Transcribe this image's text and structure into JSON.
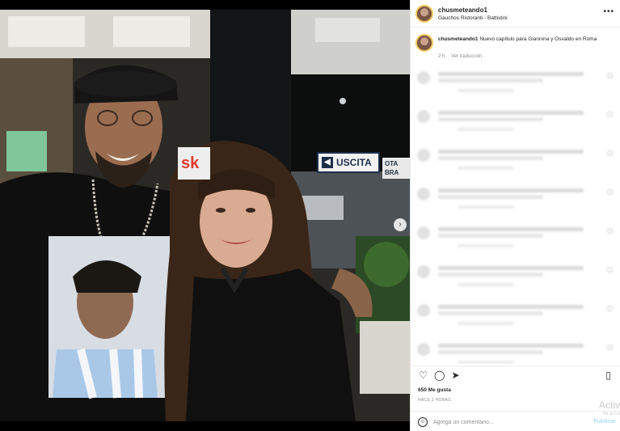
{
  "header": {
    "username": "chusmeteando1",
    "location": "Gauchos Ristoranti - Battistini",
    "more_icon": "more-horizontal-icon"
  },
  "caption": {
    "username": "chusmeteando1",
    "text": "Nuevo capítulo para Giannina y Osvaldo en Roma",
    "age": "2 h",
    "translation_link": "Ver traducción"
  },
  "photo": {
    "sign_uscita": "USCITA",
    "sign_sk": "sk",
    "sign_ota": "OTA BRA",
    "carousel_active_index": 0,
    "carousel_count": 3
  },
  "actions": {
    "like_icon": "heart-icon",
    "comment_icon": "comment-icon",
    "share_icon": "share-icon",
    "save_icon": "bookmark-icon"
  },
  "likes": "650 Me gusta",
  "posted": "HACE 2 HORAS",
  "comment_box": {
    "placeholder": "Agrega un comentario...",
    "publish_label": "Publicar"
  },
  "watermark": {
    "line1": "Activ",
    "line2": "Ve a Co"
  },
  "colors": {
    "accent_blue": "#0095f6",
    "publish_disabled": "#b2dffc"
  }
}
